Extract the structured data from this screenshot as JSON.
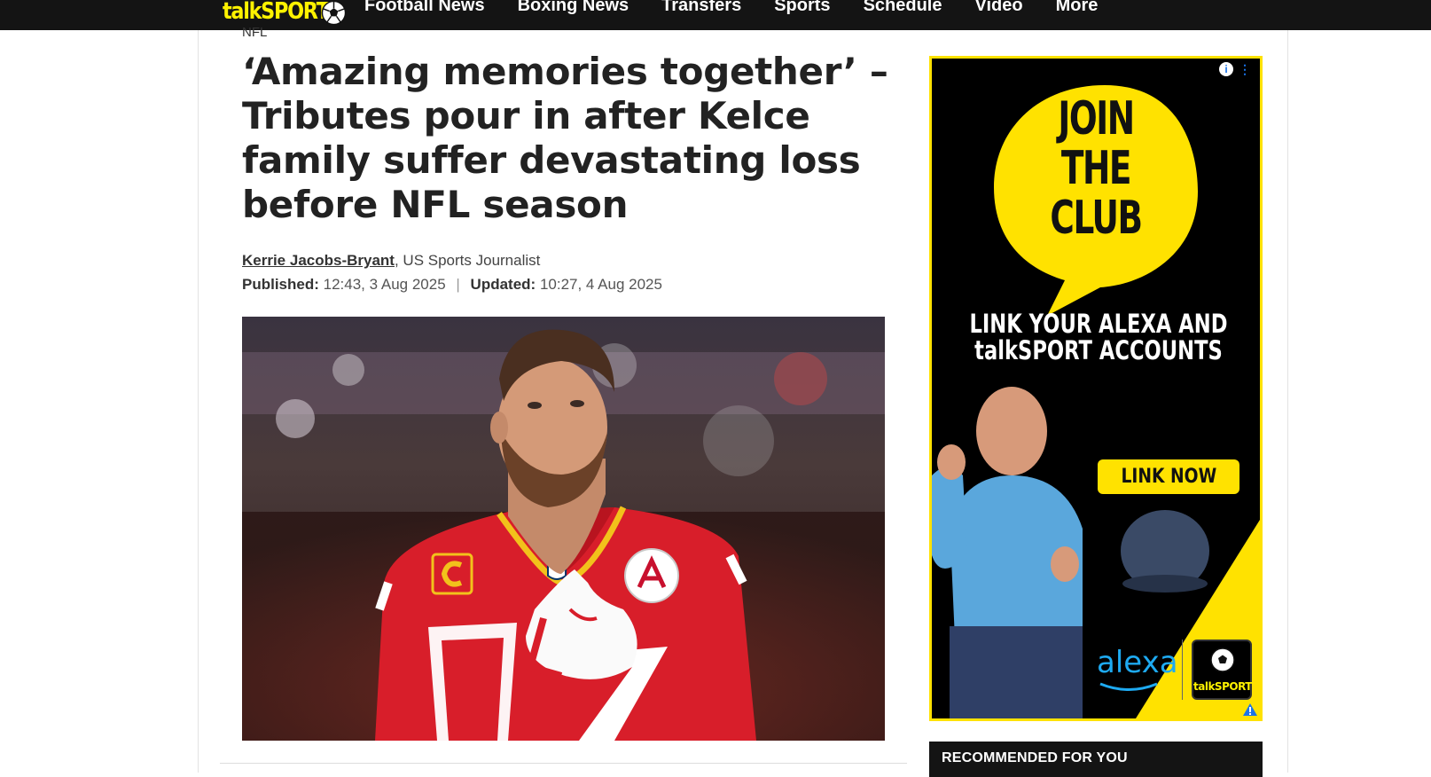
{
  "header": {
    "logo_text": "talkSPORT",
    "nav": [
      "Football News",
      "Boxing News",
      "Transfers",
      "Sports",
      "Schedule",
      "Video",
      "More"
    ]
  },
  "article": {
    "category": "NFL",
    "headline": "‘Amazing memories together’ – Tributes pour in after Kelce family suffer devastating loss before NFL season",
    "author": "Kerrie Jacobs-Bryant",
    "author_role": ", US Sports Journalist",
    "published_label": "Published:",
    "published_value": " 12:43, 3 Aug 2025",
    "updated_label": "Updated:",
    "updated_value": " 10:27, 4 Aug 2025",
    "separator": "|"
  },
  "ad": {
    "headline": "JOIN THE CLUB",
    "line1": "LINK YOUR ALEXA AND",
    "line2": "talkSPORT ACCOUNTS",
    "cta": "LINK NOW",
    "alexa_brand": "alexa",
    "badge_text": "talkSPORT",
    "info_glyph": "i",
    "menu_glyph": "⋮"
  },
  "sidebar": {
    "recommended_title": "RECOMMENDED FOR YOU"
  },
  "colors": {
    "brand_yellow": "#fff200",
    "nav_bg": "#141414",
    "jersey_red": "#d81e2a",
    "alexa_blue": "#1eaaf1"
  }
}
